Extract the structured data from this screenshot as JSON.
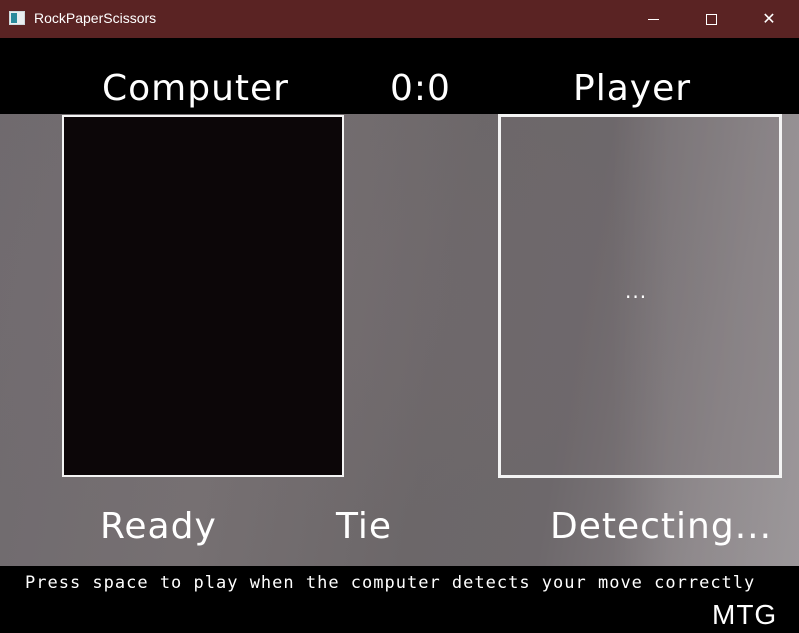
{
  "window": {
    "title": "RockPaperScissors",
    "icon": "app-window-icon",
    "controls": {
      "minimize": "minimize-icon",
      "maximize": "maximize-icon",
      "close_glyph": "✕"
    }
  },
  "game": {
    "computer_label": "Computer",
    "score": "0:0",
    "player_label": "Player",
    "player_detection": "...",
    "computer_status": "Ready",
    "round_result": "Tie",
    "player_status": "Detecting...",
    "instruction": "Press space to play when the computer detects your move correctly",
    "watermark": "MTG"
  },
  "colors": {
    "titlebar": "#5a2323",
    "text": "#ffffff",
    "box_border": "#f4f4f4",
    "band": "#000000"
  }
}
